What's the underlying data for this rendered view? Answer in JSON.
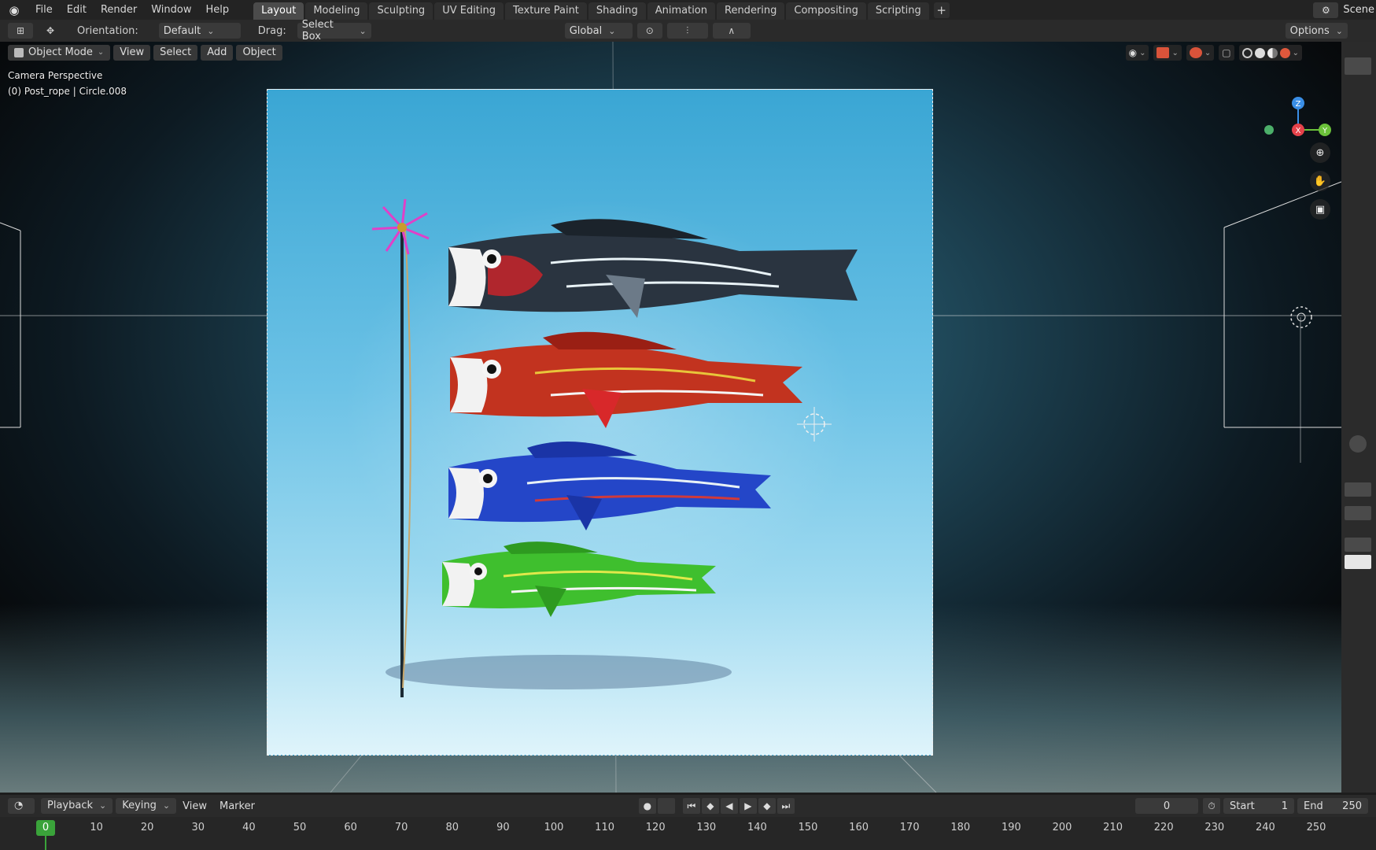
{
  "topbar": {
    "menus": [
      "File",
      "Edit",
      "Render",
      "Window",
      "Help"
    ],
    "workspace_tabs": [
      "Layout",
      "Modeling",
      "Sculpting",
      "UV Editing",
      "Texture Paint",
      "Shading",
      "Animation",
      "Rendering",
      "Compositing",
      "Scripting"
    ],
    "active_tab": "Layout",
    "add_tab": "+",
    "scene_label": "Scene"
  },
  "toolbar": {
    "orientation_label": "Orientation:",
    "orientation_value": "Default",
    "drag_label": "Drag:",
    "drag_value": "Select Box",
    "transform_orientation": "Global",
    "options_label": "Options"
  },
  "viewport": {
    "mode": "Object Mode",
    "menus": [
      "View",
      "Select",
      "Add",
      "Object"
    ],
    "view_name": "Camera Perspective",
    "active_object": "(0) Post_rope | Circle.008",
    "gizmo_axes": {
      "z": "Z",
      "x": "X",
      "y": "Y"
    },
    "colors": {
      "x_axis": "#e5424a",
      "y_axis": "#6bc13a",
      "z_axis": "#3a8ee6"
    }
  },
  "scene": {
    "koi": [
      {
        "name": "black-koi",
        "body": "#2a3440",
        "accent": "#c8242a"
      },
      {
        "name": "red-koi",
        "body": "#c2331f",
        "accent": "#e8c53a"
      },
      {
        "name": "blue-koi",
        "body": "#2446c8",
        "accent": "#d03a3a"
      },
      {
        "name": "green-koi",
        "body": "#3fbf2e",
        "accent": "#e0e84a"
      }
    ],
    "pinwheel_color": "#e040c8"
  },
  "timeline": {
    "menus": [
      "Playback",
      "Keying",
      "View",
      "Marker"
    ],
    "current_frame": "0",
    "start_label": "Start",
    "start_value": "1",
    "end_label": "End",
    "end_value": "250",
    "ticks": [
      "0",
      "10",
      "20",
      "30",
      "40",
      "50",
      "60",
      "70",
      "80",
      "90",
      "100",
      "110",
      "120",
      "130",
      "140",
      "150",
      "160",
      "170",
      "180",
      "190",
      "200",
      "210",
      "220",
      "230",
      "240",
      "250"
    ]
  }
}
